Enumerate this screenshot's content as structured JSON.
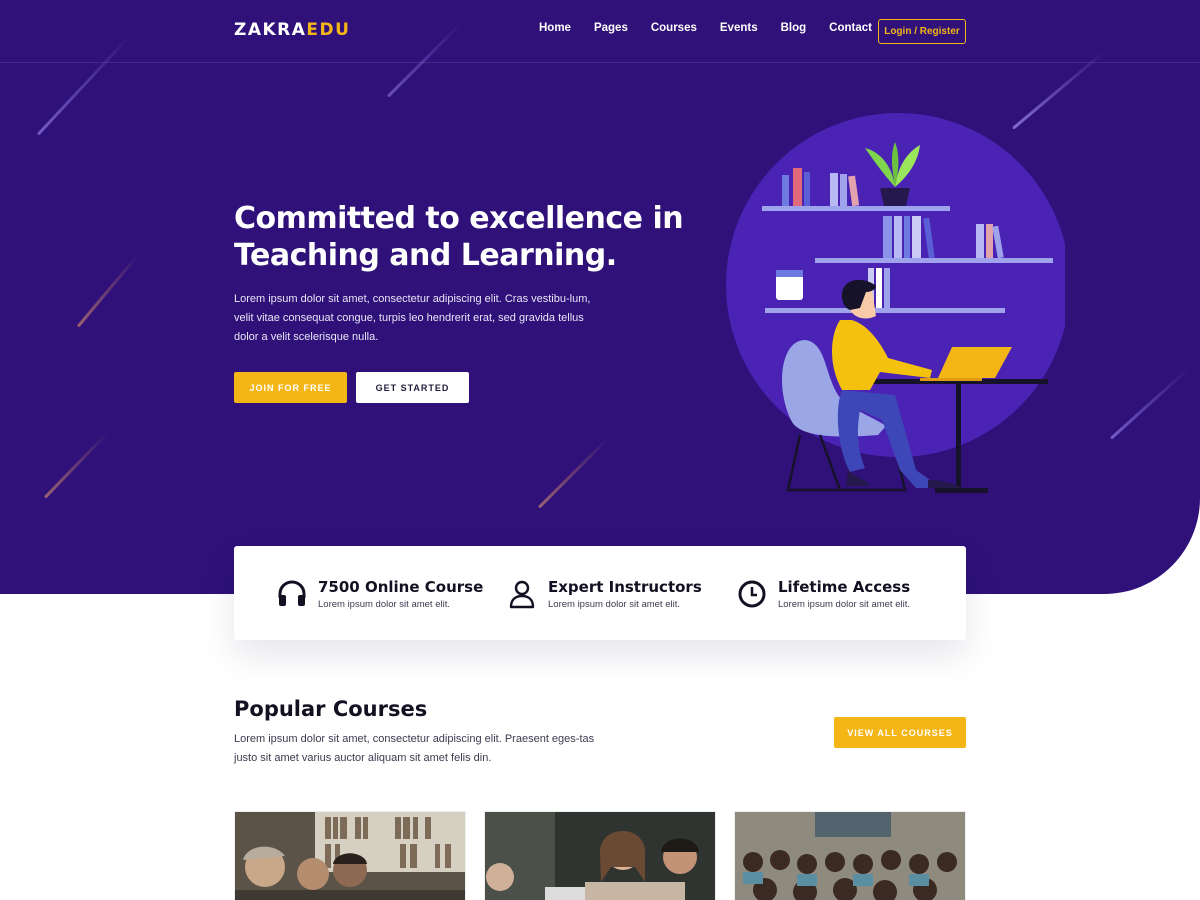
{
  "brand": {
    "name_part1": "ZAKRA",
    "name_part2": "EDU"
  },
  "nav": {
    "items": [
      "Home",
      "Pages",
      "Courses",
      "Events",
      "Blog",
      "Contact"
    ],
    "login_label": "Login / Register"
  },
  "hero": {
    "title": "Committed to excellence in Teaching and Learning.",
    "description": "Lorem ipsum dolor sit amet, consectetur adipiscing elit. Cras vestibu-lum, velit vitae consequat congue, turpis leo hendrerit erat, sed gravida tellus dolor a velit scelerisque nulla.",
    "join_label": "JOIN FOR FREE",
    "start_label": "GET STARTED"
  },
  "features": [
    {
      "icon": "headphones-icon",
      "title": "7500 Online Course",
      "subtitle": "Lorem ipsum dolor sit amet elit."
    },
    {
      "icon": "user-icon",
      "title": "Expert Instructors",
      "subtitle": "Lorem ipsum dolor sit amet elit."
    },
    {
      "icon": "clock-icon",
      "title": "Lifetime Access",
      "subtitle": "Lorem ipsum dolor sit amet elit."
    }
  ],
  "courses": {
    "title": "Popular Courses",
    "description": "Lorem ipsum dolor sit amet, consectetur adipiscing elit. Praesent eges-tas justo sit amet varius auctor aliquam sit amet felis din.",
    "view_all_label": "VIEW ALL COURSES",
    "cards": [
      {
        "image": "students-library-photo"
      },
      {
        "image": "students-laptop-photo"
      },
      {
        "image": "classroom-children-photo"
      }
    ]
  },
  "colors": {
    "hero_bg": "#2f1179",
    "accent": "#f4b517",
    "circle": "#4a23b5"
  }
}
